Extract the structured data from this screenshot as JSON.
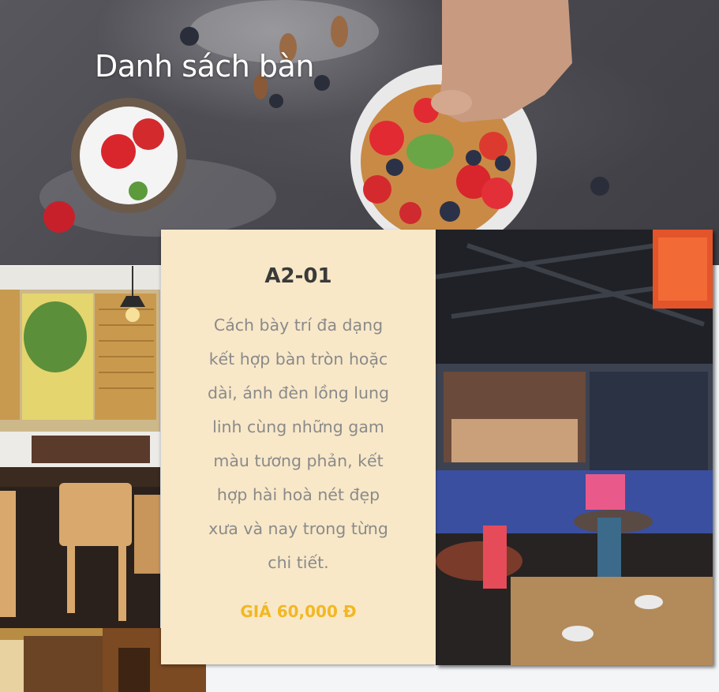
{
  "page": {
    "title": "Danh sách bàn"
  },
  "table_card": {
    "code": "A2-01",
    "description": "Cách bày trí đa dạng kết hợp bàn tròn hoặc dài, ánh đèn lồng lung linh cùng những gam màu tương phản, kết hợp hài hoà nét đẹp xưa và nay trong từng chi tiết.",
    "price": "GIÁ 60,000 Đ"
  },
  "icons": {
    "hero": "food-bowl-image",
    "left_photo": "restaurant-interior-image",
    "right_photo": "restaurant-interior-image",
    "bottom_photo": "restaurant-interior-image"
  },
  "colors": {
    "card_background": "#f8e8c8",
    "price": "#f2b722",
    "title_text": "#3a3a3a",
    "description_text": "#8a8a8a",
    "hero_text": "#ffffff"
  }
}
